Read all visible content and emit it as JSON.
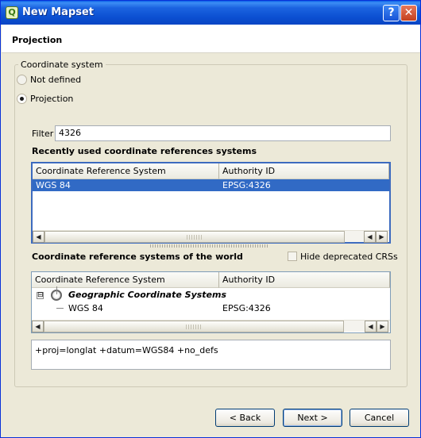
{
  "window": {
    "title": "New Mapset",
    "help_label": "?",
    "close_label": "✕"
  },
  "header": {
    "title": "Projection"
  },
  "coordinate_system": {
    "legend": "Coordinate system",
    "options": [
      {
        "label": "Not defined",
        "checked": false
      },
      {
        "label": "Projection",
        "checked": true
      }
    ]
  },
  "filter": {
    "label": "Filter",
    "value": "4326"
  },
  "recent": {
    "title": "Recently used coordinate references systems",
    "columns": [
      "Coordinate Reference System",
      "Authority ID"
    ],
    "rows": [
      {
        "name": "WGS 84",
        "authority": "EPSG:4326",
        "selected": true
      }
    ]
  },
  "world": {
    "title": "Coordinate reference systems of the world",
    "hide_deprecated_label": "Hide deprecated CRSs",
    "hide_deprecated_checked": false,
    "columns": [
      "Coordinate Reference System",
      "Authority ID"
    ],
    "group": {
      "label": "Geographic Coordinate Systems",
      "expander": "⊟"
    },
    "rows": [
      {
        "name": "WGS 84",
        "authority": "EPSG:4326"
      }
    ]
  },
  "proj_string": "+proj=longlat +datum=WGS84 +no_defs",
  "buttons": {
    "back": "< Back",
    "next": "Next >",
    "cancel": "Cancel"
  },
  "icons": {
    "app": "qgis-icon",
    "globe": "globe-crosshair-icon"
  },
  "colors": {
    "titlebar": "#0b4fd1",
    "selection": "#316ac5",
    "dialog_bg": "#ece9d8"
  }
}
